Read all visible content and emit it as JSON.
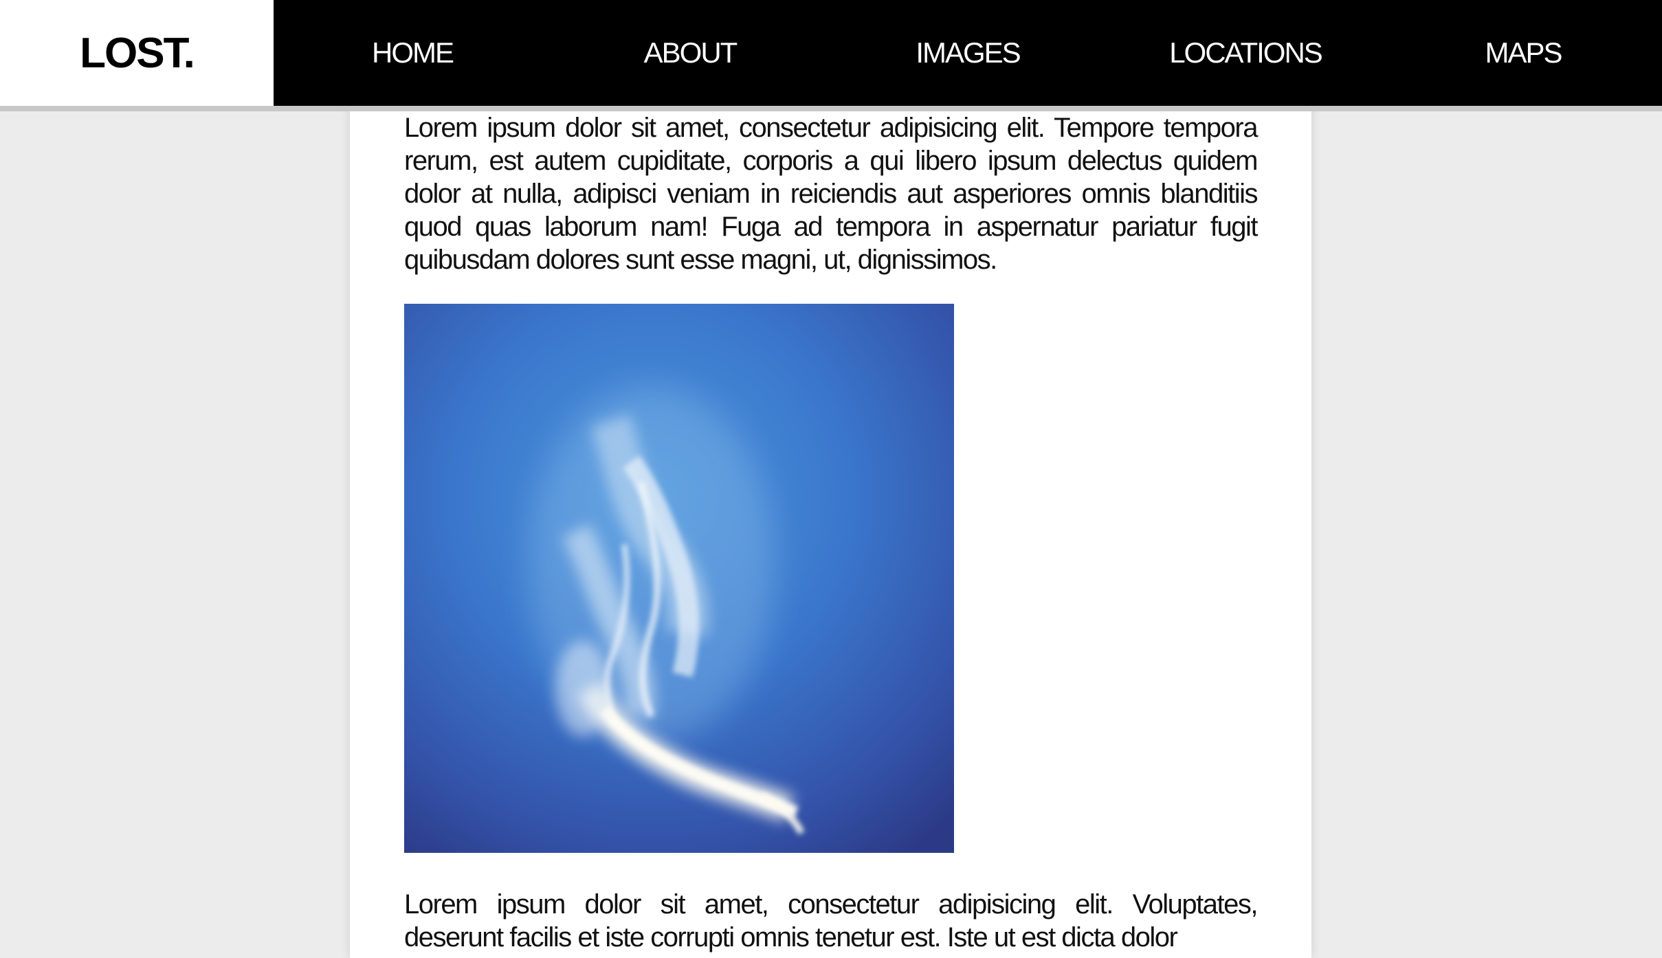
{
  "header": {
    "logo": "LOST.",
    "nav": [
      {
        "label": "HOME"
      },
      {
        "label": "ABOUT"
      },
      {
        "label": "IMAGES"
      },
      {
        "label": "LOCATIONS"
      },
      {
        "label": "MAPS"
      }
    ]
  },
  "main": {
    "paragraph_1": "Lorem ipsum dolor sit amet, consectetur adipisicing elit. Tempore tempora rerum, est autem cupiditate, corporis a qui libero ipsum delectus quidem dolor at nulla, adipisci veniam in reiciendis aut asperiores omnis blanditiis quod quas laborum nam! Fuga ad tempora in aspernatur pariatur fugit quibusdam dolores sunt esse magni, ut, dignissimos.",
    "image": {
      "subject": "cloud-in-blue-sky-photo"
    },
    "paragraph_2": "Lorem ipsum dolor sit amet, consectetur adipisicing elit. Voluptates, deserunt facilis et iste corrupti omnis tenetur est. Iste ut est dicta dolor"
  },
  "colors": {
    "header_bg": "#000000",
    "logo_bg": "#ffffff",
    "page_bg": "#ececec",
    "content_bg": "#ffffff",
    "sky_blue": "#3d7fd0",
    "sky_vignette": "#2c3d8c"
  }
}
